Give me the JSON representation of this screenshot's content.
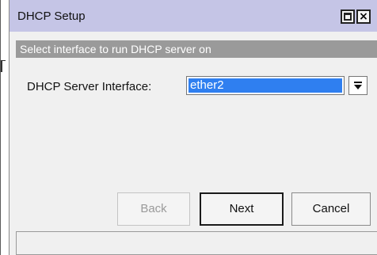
{
  "window": {
    "title": "DHCP Setup",
    "maximize_glyph": "",
    "close_glyph": "×"
  },
  "banner": {
    "text": "Select interface to run DHCP server on"
  },
  "form": {
    "interface_label": "DHCP Server Interface:",
    "interface_value": "ether2"
  },
  "buttons": {
    "back": "Back",
    "next": "Next",
    "cancel": "Cancel"
  },
  "colors": {
    "titlebar": "#c5c5e6",
    "banner": "#9a9a9a",
    "selection": "#2f7ff0"
  }
}
